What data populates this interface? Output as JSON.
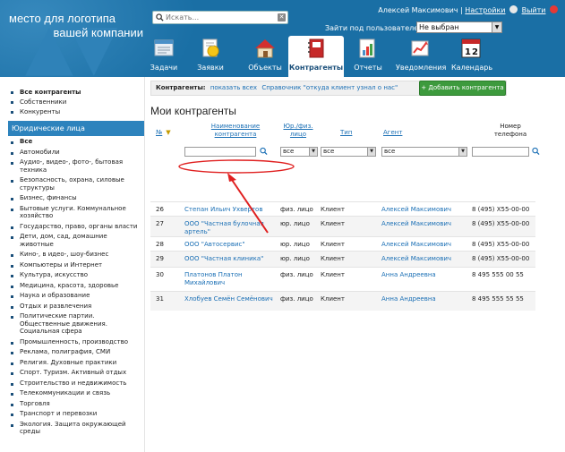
{
  "colors": {
    "header_bg": "#1a6fa5",
    "link": "#1a6fb5",
    "add_button": "#3d9a3d",
    "sidebar_header": "#2d83bd",
    "annotation": "#e02020"
  },
  "logo": {
    "line1": "место для логотипа",
    "line2": "вашей компании"
  },
  "search": {
    "placeholder": "Искать...",
    "icon": "search-icon"
  },
  "user": {
    "name": "Алексей Максимович",
    "separator": "|",
    "settings": "Настройки",
    "logout": "Выйти"
  },
  "login_as": {
    "label": "Зайти под пользователем:",
    "selected": "Не выбран"
  },
  "nav": [
    {
      "label": "Задачи",
      "icon": "tasks-icon"
    },
    {
      "label": "Заявки",
      "icon": "requests-icon"
    },
    {
      "label": "Объекты",
      "icon": "house-icon"
    },
    {
      "label": "Контрагенты",
      "icon": "contacts-book-icon",
      "active": true
    },
    {
      "label": "Отчеты",
      "icon": "report-icon"
    },
    {
      "label": "Уведомления",
      "icon": "notifications-icon"
    },
    {
      "label": "Календарь",
      "icon": "calendar-icon"
    }
  ],
  "sidebar": {
    "top": [
      "Все контрагенты",
      "Собственники",
      "Конкуренты"
    ],
    "header": "Юридические лица",
    "categories": [
      "Все",
      "Автомобили",
      "Аудио-, видео-, фото-, бытовая техника",
      "Безопасность, охрана, силовые структуры",
      "Бизнес, финансы",
      "Бытовые услуги. Коммунальное хозяйство",
      "Государство, право, органы власти",
      "Дети, дом, сад, домашние животные",
      "Кино-, в идео-, шоу-бизнес",
      "Компьютеры и Интернет",
      "Культура, искусство",
      "Медицина, красота, здоровье",
      "Наука и образование",
      "Отдых и развлечения",
      "Политические партии. Общественные движения. Социальная сфера",
      "Промышленность, производство",
      "Реклама, полиграфия, СМИ",
      "Религия. Духовные практики",
      "Спорт. Туризм. Активный отдых",
      "Строительство и недвижимость",
      "Телекоммуникации и связь",
      "Торговля",
      "Транспорт и перевозки",
      "Экология. Защита окружающей среды"
    ]
  },
  "bar": {
    "label": "Контрагенты:",
    "show_all": "показать всех",
    "handbook": "Справочник \"откуда клиент узнал о нас\""
  },
  "add_button": "+ Добавить контрагента",
  "page_title": "Мои контрагенты",
  "table": {
    "headers": {
      "num": "№",
      "name": "Наименование контрагента",
      "jur": "Юр./физ. лицо",
      "type": "Тип",
      "agent": "Агент",
      "phone": "Номер телефона"
    },
    "filters": {
      "jur": "все",
      "type": "все",
      "agent": "все"
    },
    "rows": [
      {
        "num": "26",
        "name": "Степан Ильич Ухвертов",
        "jur": "физ. лицо",
        "type": "Клиент",
        "agent": "Алексей Максимович",
        "phone": "8 (495) X55-00-00"
      },
      {
        "num": "27",
        "name": "ООО \"Частная булочная артель\"",
        "jur": "юр. лицо",
        "type": "Клиент",
        "agent": "Алексей Максимович",
        "phone": "8 (495) X55-00-00"
      },
      {
        "num": "28",
        "name": "ООО \"Автосервис\"",
        "jur": "юр. лицо",
        "type": "Клиент",
        "agent": "Алексей Максимович",
        "phone": "8 (495) X55-00-00"
      },
      {
        "num": "29",
        "name": "ООО \"Частная клиника\"",
        "jur": "юр. лицо",
        "type": "Клиент",
        "agent": "Алексей Максимович",
        "phone": "8 (495) X55-00-00"
      },
      {
        "num": "30",
        "name": "Платонов Платон Михайлович",
        "jur": "физ. лицо",
        "type": "Клиент",
        "agent": "Анна Андреевна",
        "phone": "8 495 555 00 55"
      },
      {
        "num": "31",
        "name": "Хлобуев Семён Семёнович",
        "jur": "физ. лицо",
        "type": "Клиент",
        "agent": "Анна Андреевна",
        "phone": "8 495 555 55 55"
      }
    ]
  }
}
